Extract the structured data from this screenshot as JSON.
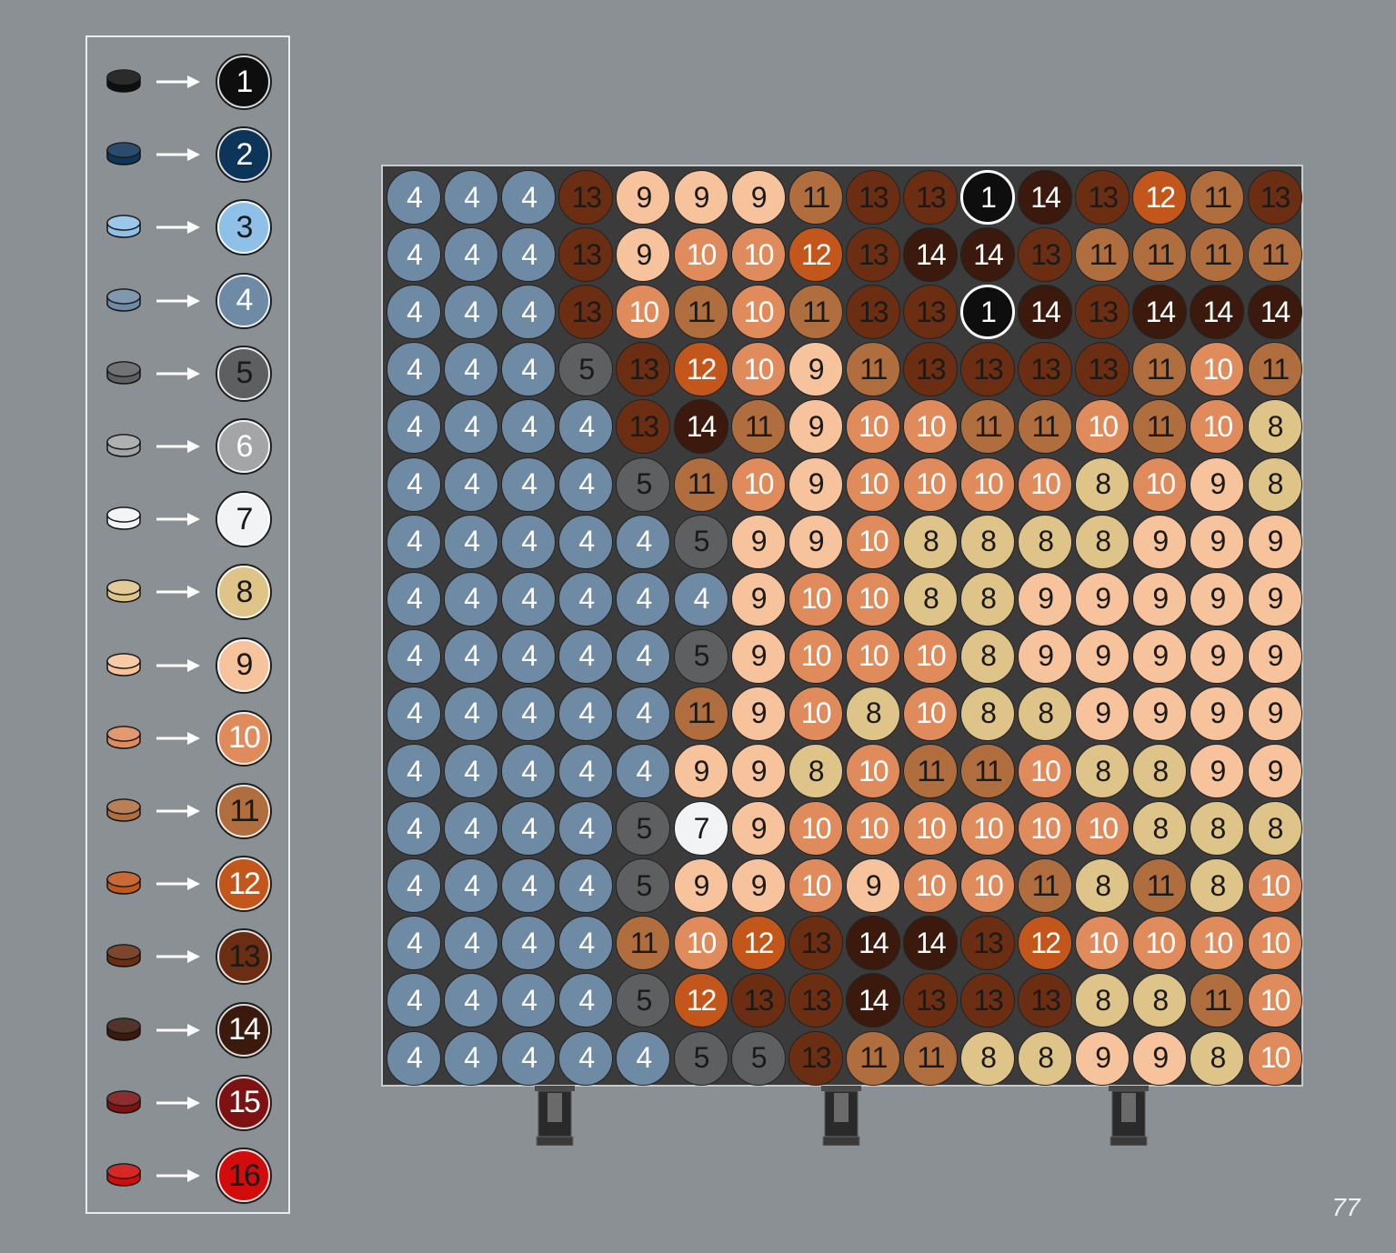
{
  "legend": [
    {
      "number": "1",
      "color": "#0e0e0e",
      "text": "#ffffff"
    },
    {
      "number": "2",
      "color": "#0d3559",
      "text": "#ffffff"
    },
    {
      "number": "3",
      "color": "#8fc0e8",
      "text": "#1a1a1a"
    },
    {
      "number": "4",
      "color": "#6f8aa4",
      "text": "#ffffff"
    },
    {
      "number": "5",
      "color": "#5e5f60",
      "text": "#1a1a1a"
    },
    {
      "number": "6",
      "color": "#a4a5a6",
      "text": "#ffffff"
    },
    {
      "number": "7",
      "color": "#f2f3f5",
      "text": "#1a1a1a"
    },
    {
      "number": "8",
      "color": "#dfc48a",
      "text": "#1a1a1a"
    },
    {
      "number": "9",
      "color": "#f7c39d",
      "text": "#1a1a1a"
    },
    {
      "number": "10",
      "color": "#e08b5c",
      "text": "#ffffff"
    },
    {
      "number": "11",
      "color": "#b06e3f",
      "text": "#1a1a1a"
    },
    {
      "number": "12",
      "color": "#c2561b",
      "text": "#ffffff"
    },
    {
      "number": "13",
      "color": "#6b2e12",
      "text": "#1a1a1a"
    },
    {
      "number": "14",
      "color": "#3b1a0d",
      "text": "#ffffff"
    },
    {
      "number": "15",
      "color": "#7d1212",
      "text": "#ffffff"
    },
    {
      "number": "16",
      "color": "#d20b0b",
      "text": "#1a1a1a"
    }
  ],
  "mosaic": {
    "rows": [
      [
        4,
        4,
        4,
        13,
        9,
        9,
        9,
        11,
        13,
        13,
        1,
        14,
        13,
        12,
        11,
        13
      ],
      [
        4,
        4,
        4,
        13,
        9,
        10,
        10,
        12,
        13,
        14,
        14,
        13,
        11,
        11,
        11,
        11
      ],
      [
        4,
        4,
        4,
        13,
        10,
        11,
        10,
        11,
        13,
        13,
        1,
        14,
        13,
        14,
        14,
        14
      ],
      [
        4,
        4,
        4,
        5,
        13,
        12,
        10,
        9,
        11,
        13,
        13,
        13,
        13,
        11,
        10,
        11
      ],
      [
        4,
        4,
        4,
        4,
        13,
        14,
        11,
        9,
        10,
        10,
        11,
        11,
        10,
        11,
        10,
        8
      ],
      [
        4,
        4,
        4,
        4,
        5,
        11,
        10,
        9,
        10,
        10,
        10,
        10,
        8,
        10,
        9,
        8
      ],
      [
        4,
        4,
        4,
        4,
        4,
        5,
        9,
        9,
        10,
        8,
        8,
        8,
        8,
        9,
        9,
        9
      ],
      [
        4,
        4,
        4,
        4,
        4,
        4,
        9,
        10,
        10,
        8,
        8,
        9,
        9,
        9,
        9,
        9
      ],
      [
        4,
        4,
        4,
        4,
        4,
        5,
        9,
        10,
        10,
        10,
        8,
        9,
        9,
        9,
        9,
        9
      ],
      [
        4,
        4,
        4,
        4,
        4,
        11,
        9,
        10,
        8,
        10,
        8,
        8,
        9,
        9,
        9,
        9
      ],
      [
        4,
        4,
        4,
        4,
        4,
        9,
        9,
        8,
        10,
        11,
        11,
        10,
        8,
        8,
        9,
        9
      ],
      [
        4,
        4,
        4,
        4,
        5,
        7,
        9,
        10,
        10,
        10,
        10,
        10,
        10,
        8,
        8,
        8
      ],
      [
        4,
        4,
        4,
        4,
        5,
        9,
        9,
        10,
        9,
        10,
        10,
        11,
        8,
        11,
        8,
        10
      ],
      [
        4,
        4,
        4,
        4,
        11,
        10,
        12,
        13,
        14,
        14,
        13,
        12,
        10,
        10,
        10,
        10
      ],
      [
        4,
        4,
        4,
        4,
        5,
        12,
        13,
        13,
        14,
        13,
        13,
        13,
        8,
        8,
        11,
        10
      ],
      [
        4,
        4,
        4,
        4,
        4,
        5,
        5,
        13,
        11,
        11,
        8,
        8,
        9,
        9,
        8,
        10
      ]
    ]
  },
  "page_number": "77"
}
